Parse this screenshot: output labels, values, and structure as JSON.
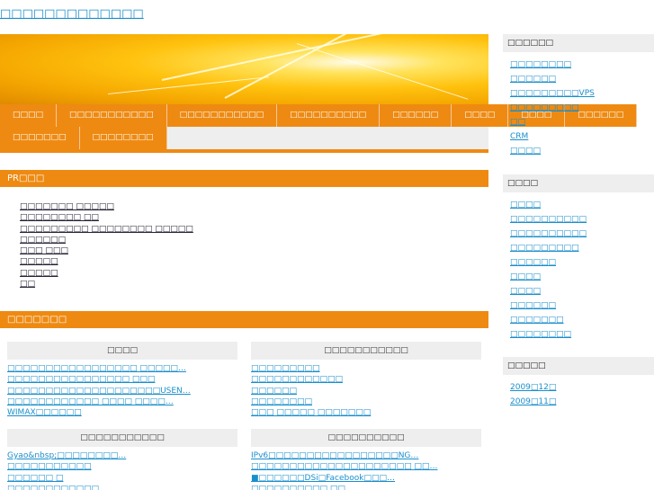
{
  "site_title": "□□□□□□□□□□□□□",
  "nav": {
    "row1": [
      "□□□□",
      "□□□□□□□□□□□",
      "□□□□□□□□□□□",
      "□□□□□□□□□□",
      "□□□□□□",
      "□□□□",
      "□□□□",
      "□□□□□□"
    ],
    "row2": [
      "□□□□□□□",
      "□□□□□□□□"
    ]
  },
  "pr": {
    "heading": "PR□□□",
    "links": [
      "□□□□□□□ □□□□□",
      "□□□□□□□□ □□",
      "□□□□□□□□□ □□□□□□□□ □□□□□",
      "□□□□□□",
      "□□□ □□□",
      "□□□□□",
      "□□□□□",
      "□□"
    ]
  },
  "categories": {
    "heading": "□□□□□□□",
    "boxes": [
      {
        "title": "□□□□",
        "links": [
          "□□□□□□□□□□□□□□□□□ □□□□□…",
          "□□□□□□□□□□□□□□□□ □□□",
          "□□□□□□□□□□□□□□□□□□□□USEN…",
          "□□□□□□□□□□□□ □□□□ □□□□…",
          "WIMAX□□□□□□"
        ]
      },
      {
        "title": "□□□□□□□□□□□",
        "links": [
          "□□□□□□□□□",
          "□□□□□□□□□□□□",
          "□□□□□□",
          "□□□□□□□□",
          "□□□ □□□□□ □□□□□□□"
        ]
      },
      {
        "title": "□□□□□□□□□□□",
        "links": [
          "Gyao&nbsp;□□□□□□□□…",
          "□□□□□□□□□□□",
          "□□□□□□ □",
          "□□□□□□□□□□□□"
        ]
      },
      {
        "title": "□□□□□□□□□□",
        "links": [
          "IPv6□□□□□□□□□□□□□□□□□NG…",
          "□□□□□□□□□□□□□□□□□□□□□ □□…",
          "■□□□□□□DSi□Facebook□□□…",
          "□□□□□□□□□□ □□"
        ]
      }
    ]
  },
  "sidebar": {
    "sections": [
      {
        "title": "□□□□□□",
        "links": [
          "□□□□□□□□",
          "□□□□□□",
          "□□□□□□□□□VPS",
          "□□□□□□□□□",
          "□□",
          "CRM",
          "□□□□"
        ]
      },
      {
        "title": "□□□□",
        "links": [
          "□□□□",
          "□□□□□□□□□□",
          "□□□□□□□□□□",
          "□□□□□□□□□",
          "□□□□□□",
          "□□□□",
          "□□□□",
          "□□□□□□",
          "□□□□□□□",
          "□□□□□□□□"
        ]
      },
      {
        "title": "□□□□□",
        "links": [
          "2009□12□",
          "2009□11□"
        ]
      }
    ]
  },
  "colors": {
    "accent": "#ee8a12",
    "link": "#1a8ecb",
    "panel": "#eeeeee"
  }
}
